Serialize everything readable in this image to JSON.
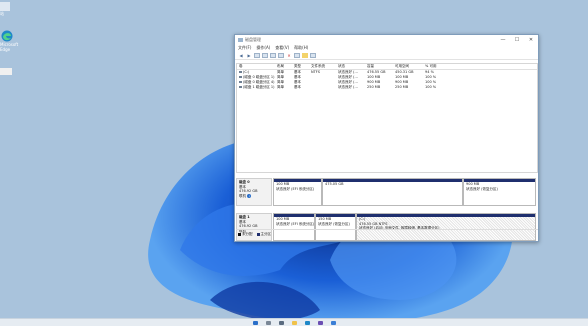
{
  "window": {
    "title": "磁盘管理",
    "minimize": "—",
    "maximize": "☐",
    "close": "✕"
  },
  "menu": [
    "文件(F)",
    "操作(A)",
    "查看(V)",
    "帮助(H)"
  ],
  "volumes": {
    "headers": [
      "卷",
      "布局",
      "类型",
      "文件系统",
      "状态",
      "容量",
      "可用空间",
      "% 可用"
    ],
    "rows": [
      [
        "(C:)",
        "简单",
        "基本",
        "NTFS",
        "状态良好 (...",
        "476.55 GB",
        "450.31 GB",
        "94 %"
      ],
      [
        "(磁盘 0 磁盘分区 1)",
        "简单",
        "基本",
        "",
        "状态良好 (...",
        "100 MB",
        "100 MB",
        "100 %"
      ],
      [
        "(磁盘 0 磁盘分区 4)",
        "简单",
        "基本",
        "",
        "状态良好 (...",
        "900 MB",
        "900 MB",
        "100 %"
      ],
      [
        "(磁盘 1 磁盘分区 1)",
        "简单",
        "基本",
        "",
        "状态良好 (...",
        "250 MB",
        "250 MB",
        "100 %"
      ]
    ]
  },
  "disks": [
    {
      "name": "磁盘 0",
      "type": "基本",
      "size": "476.92 GB",
      "status": "联机",
      "partitions": [
        {
          "size": "100 MB",
          "status": "状态良好 (EFI 系统分区)"
        },
        {
          "size": "475.05 GB",
          "status": ""
        },
        {
          "size": "900 MB",
          "status": "状态良好 (恢复分区)"
        }
      ]
    },
    {
      "name": "磁盘 1",
      "type": "基本",
      "size": "476.92 GB",
      "status": "联机",
      "partitions": [
        {
          "size": "100 MB",
          "status": "状态良好 (EFI 系统分区)"
        },
        {
          "size": "150 MB",
          "status": "状态良好 (恢复分区)"
        },
        {
          "label": "(C:)",
          "size": "476.55 GB NTFS",
          "status": "状态良好 (启动, 页面文件, 故障转储, 基本数据分区)"
        }
      ]
    }
  ],
  "legend": [
    "未分配",
    "主分区"
  ],
  "desktop_icons": [
    {
      "label": "站"
    },
    {
      "label": "Microsoft Edge"
    },
    {
      "label": ""
    }
  ],
  "colors": {
    "wallpaper_bg": "#a9c3dc",
    "bloom_blue": "#1a5fd6",
    "partition_bar": "#1f2f6e"
  }
}
